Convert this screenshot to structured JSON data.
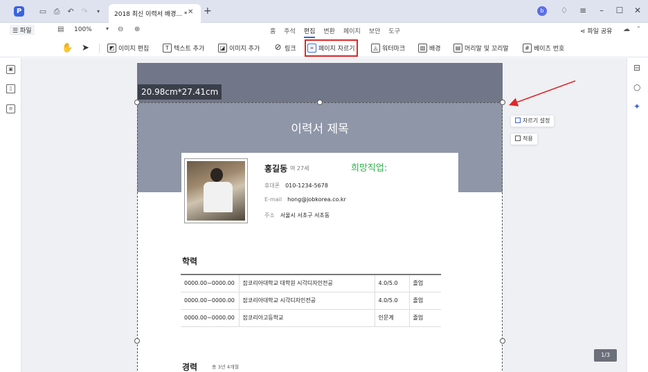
{
  "titlebar": {
    "app_logo": "P",
    "tab_title": "2018 최신 이력서 배경... *",
    "tab_close": "✕",
    "tab_add": "+",
    "avatar": "b",
    "icons": [
      "save-icon",
      "print-icon",
      "undo-icon",
      "redo-icon",
      "dropdown-icon"
    ],
    "window_buttons": [
      "notification-icon",
      "menu-icon",
      "minimize-icon",
      "maximize-icon",
      "close-icon"
    ]
  },
  "menubar": {
    "file_label": "☰ 파일",
    "zoom": "100%",
    "tabs": [
      "홈",
      "주석",
      "편집",
      "변환",
      "페이지",
      "보안",
      "도구"
    ],
    "active_tab": "편집",
    "share": "파일 공유"
  },
  "toolbar": {
    "items": [
      {
        "label": "이미지 편집",
        "icon": "image-edit-icon"
      },
      {
        "label": "텍스트 추가",
        "icon": "text-add-icon"
      },
      {
        "label": "이미지 추가",
        "icon": "image-add-icon"
      },
      {
        "label": "링크",
        "icon": "link-icon"
      },
      {
        "label": "페이지 자르기",
        "icon": "crop-icon",
        "highlighted": true
      },
      {
        "label": "워터마크",
        "icon": "watermark-icon"
      },
      {
        "label": "배경",
        "icon": "background-icon"
      },
      {
        "label": "머리말 및 꼬리말",
        "icon": "header-footer-icon"
      },
      {
        "label": "베이츠 번호",
        "icon": "bates-icon"
      }
    ]
  },
  "canvas": {
    "size_label": "20.98cm*27.41cm",
    "crop_settings": "자르기 설정",
    "apply": "적용",
    "page_indicator": "1/3"
  },
  "resume": {
    "title": "이력서 제목",
    "name": "홍길동",
    "age": "여 27세",
    "job": "희망직업:",
    "phone_label": "휴대폰",
    "phone": "010-1234-5678",
    "email_label": "E-mail",
    "email": "hong@jobkorea.co.kr",
    "address_label": "주소",
    "address": "서울시 서초구 서초동",
    "education_title": "학력",
    "education_rows": [
      [
        "0000.00~0000.00",
        "잡코리아대학교 대학원 시각디자인전공",
        "4.0/5.0",
        "졸업"
      ],
      [
        "0000.00~0000.00",
        "잡코리아대학교 시각디자인전공",
        "4.0/5.0",
        "졸업"
      ],
      [
        "0000.00~0000.00",
        "잡코리아고등학교",
        "인문계",
        "졸업"
      ]
    ],
    "career_title": "경력",
    "career_sub": "총 3년 4개월"
  },
  "colors": {
    "accent": "#3a63e0",
    "highlight_box": "#e02828",
    "header_bg": "#8e96a8",
    "job_text": "#2bb04a",
    "arrow": "#e02828"
  }
}
